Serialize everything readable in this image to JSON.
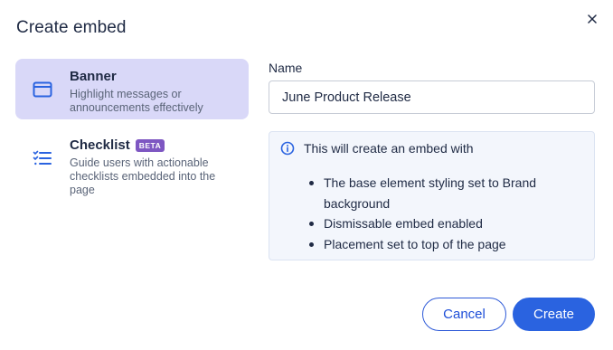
{
  "dialog": {
    "title": "Create embed",
    "close_icon": "close-icon"
  },
  "options": [
    {
      "title": "Banner",
      "description": "Highlight messages or announcements effectively",
      "icon": "browser-window-icon",
      "selected": true
    },
    {
      "title": "Checklist",
      "badge": "BETA",
      "description": "Guide users with actionable checklists embedded into the page",
      "icon": "checklist-icon",
      "selected": false
    }
  ],
  "form": {
    "name_label": "Name",
    "name_value": "June Product Release"
  },
  "info": {
    "icon": "info-icon",
    "heading": "This will create an embed with",
    "items": [
      "The base element styling set to Brand background",
      "Dismissable embed enabled",
      "Placement set to top of the page"
    ]
  },
  "buttons": {
    "cancel": "Cancel",
    "create": "Create"
  },
  "colors": {
    "selected_bg": "#d9d8f8",
    "primary": "#2a63e0",
    "beta_badge": "#7e57c2",
    "info_bg": "#f3f6fc"
  }
}
